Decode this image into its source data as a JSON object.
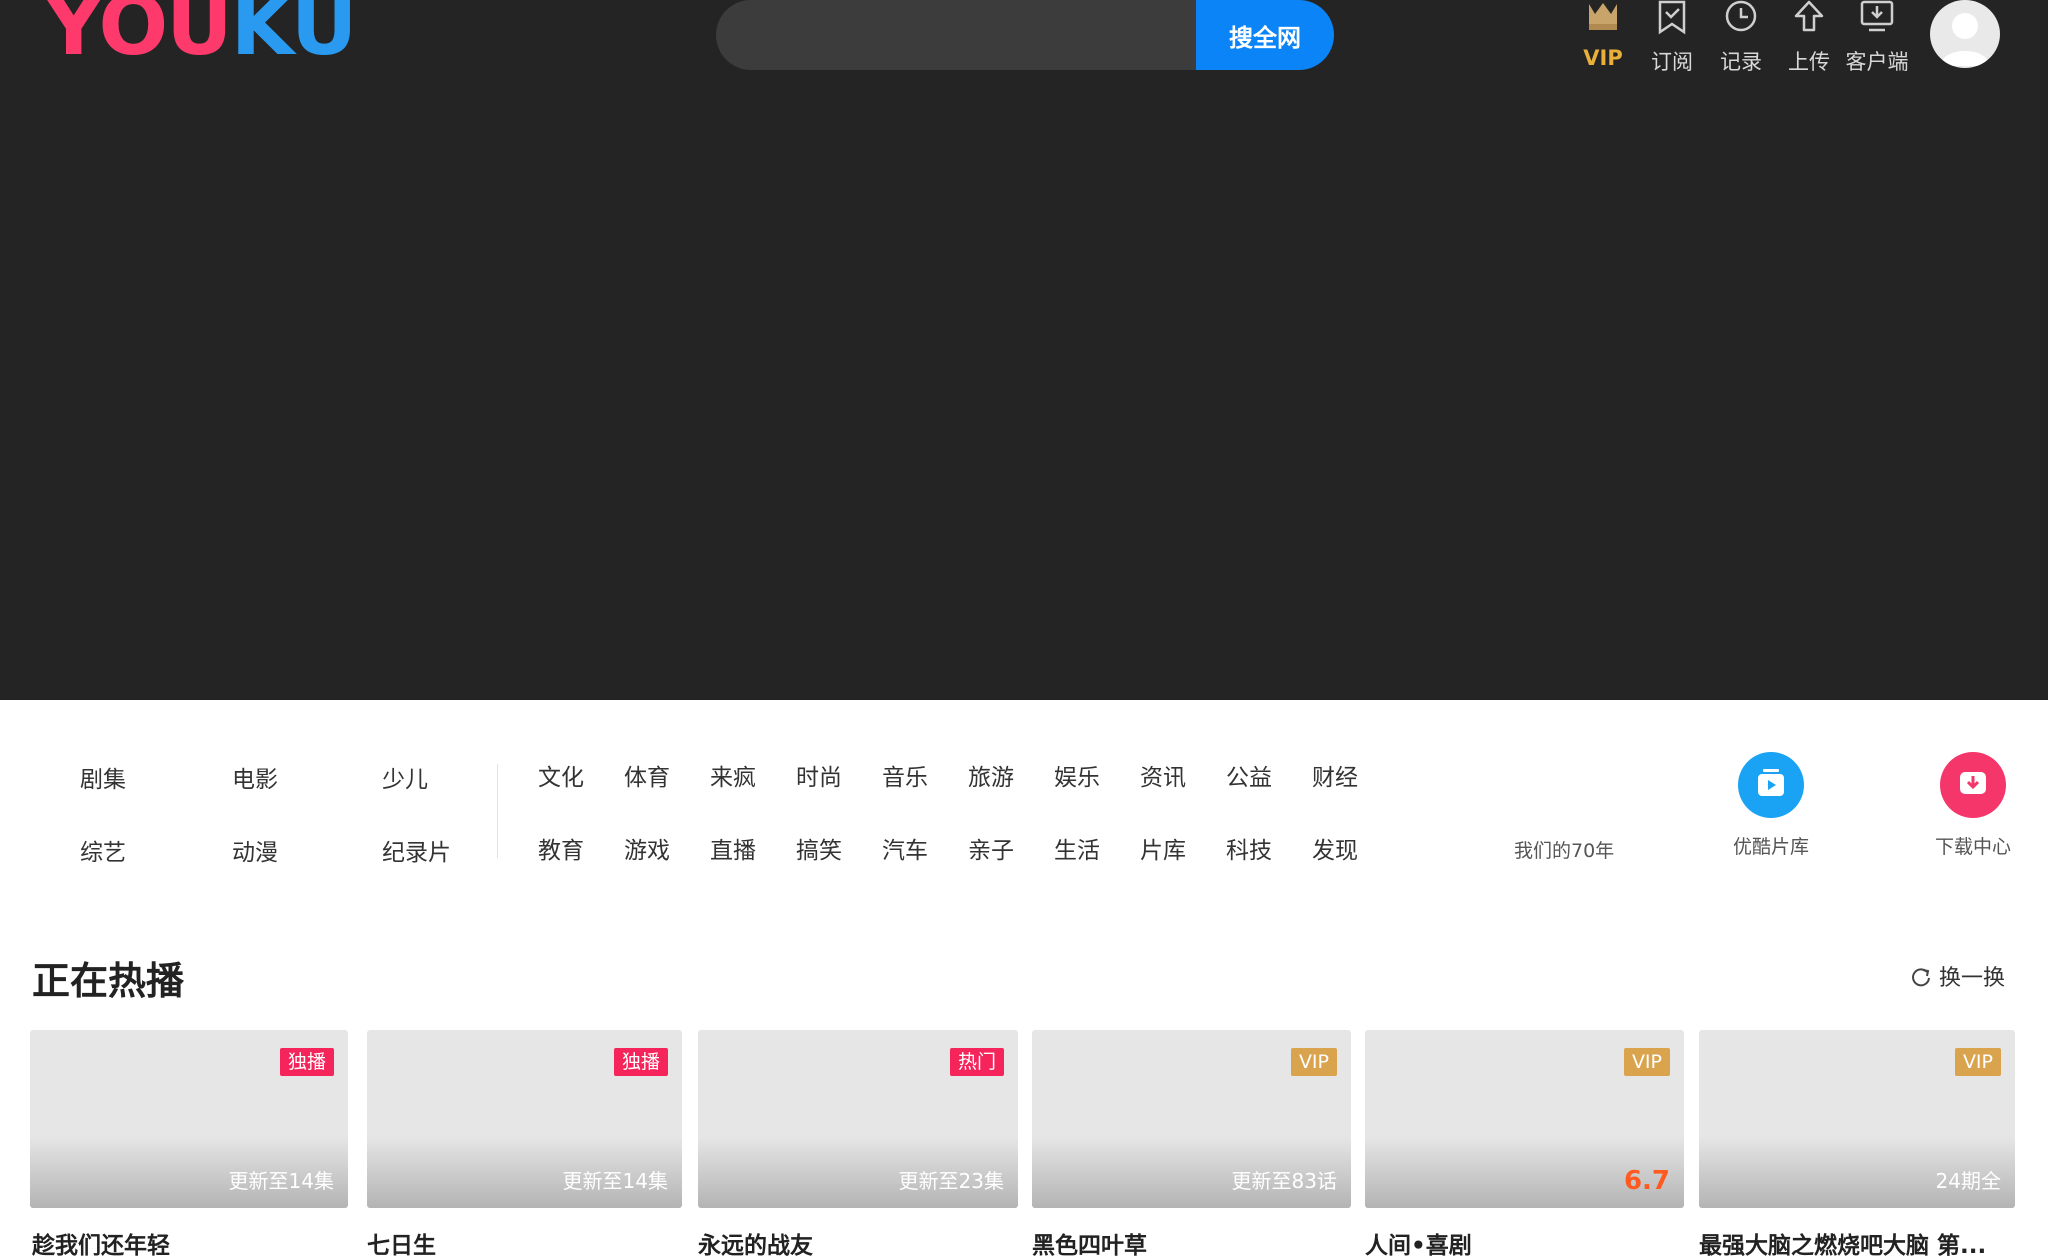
{
  "header": {
    "logo_text_a": "YOU",
    "logo_text_b": "KU",
    "search_placeholder": "",
    "search_button": "搜全网",
    "nav": [
      {
        "label": "VIP",
        "icon": "crown-icon"
      },
      {
        "label": "订阅",
        "icon": "bookmark-check-icon"
      },
      {
        "label": "记录",
        "icon": "clock-icon"
      },
      {
        "label": "上传",
        "icon": "upload-arrow-icon"
      },
      {
        "label": "客户端",
        "icon": "download-monitor-icon"
      }
    ]
  },
  "categories": {
    "primary": [
      "剧集",
      "电影",
      "少儿",
      "综艺",
      "动漫",
      "纪录片"
    ],
    "row1": [
      "文化",
      "体育",
      "来疯",
      "时尚",
      "音乐",
      "旅游",
      "娱乐",
      "资讯",
      "公益",
      "财经"
    ],
    "row2": [
      "教育",
      "游戏",
      "直播",
      "搞笑",
      "汽车",
      "亲子",
      "生活",
      "片库",
      "科技",
      "发现"
    ],
    "special": "我们的70年",
    "quick_links": [
      {
        "label": "优酷片库",
        "icon": "video-library-icon",
        "color": "#1aa3f5"
      },
      {
        "label": "下载中心",
        "icon": "download-icon",
        "color": "#f5366a"
      }
    ]
  },
  "hot": {
    "title": "正在热播",
    "refresh_label": "换一换",
    "items": [
      {
        "title": "趁我们还年轻",
        "badge": "独播",
        "info": "更新至14集"
      },
      {
        "title": "七日生",
        "badge": "独播",
        "info": "更新至14集"
      },
      {
        "title": "永远的战友",
        "badge": "热门",
        "info": "更新至23集"
      },
      {
        "title": "黑色四叶草",
        "badge": "VIP",
        "info": "更新至83话"
      },
      {
        "title": "人间•喜剧",
        "badge": "VIP",
        "info": "6.7"
      },
      {
        "title": "最强大脑之燃烧吧大脑 第...",
        "badge": "VIP",
        "info": "24期全"
      }
    ]
  },
  "colors": {
    "hero_bg": "#242424",
    "search_button": "#0b84f7",
    "vip_gold": "#e8b03a",
    "badge_red": "#f5245a",
    "badge_vip": "#d9a44d",
    "score_orange": "#ff5a1f"
  }
}
